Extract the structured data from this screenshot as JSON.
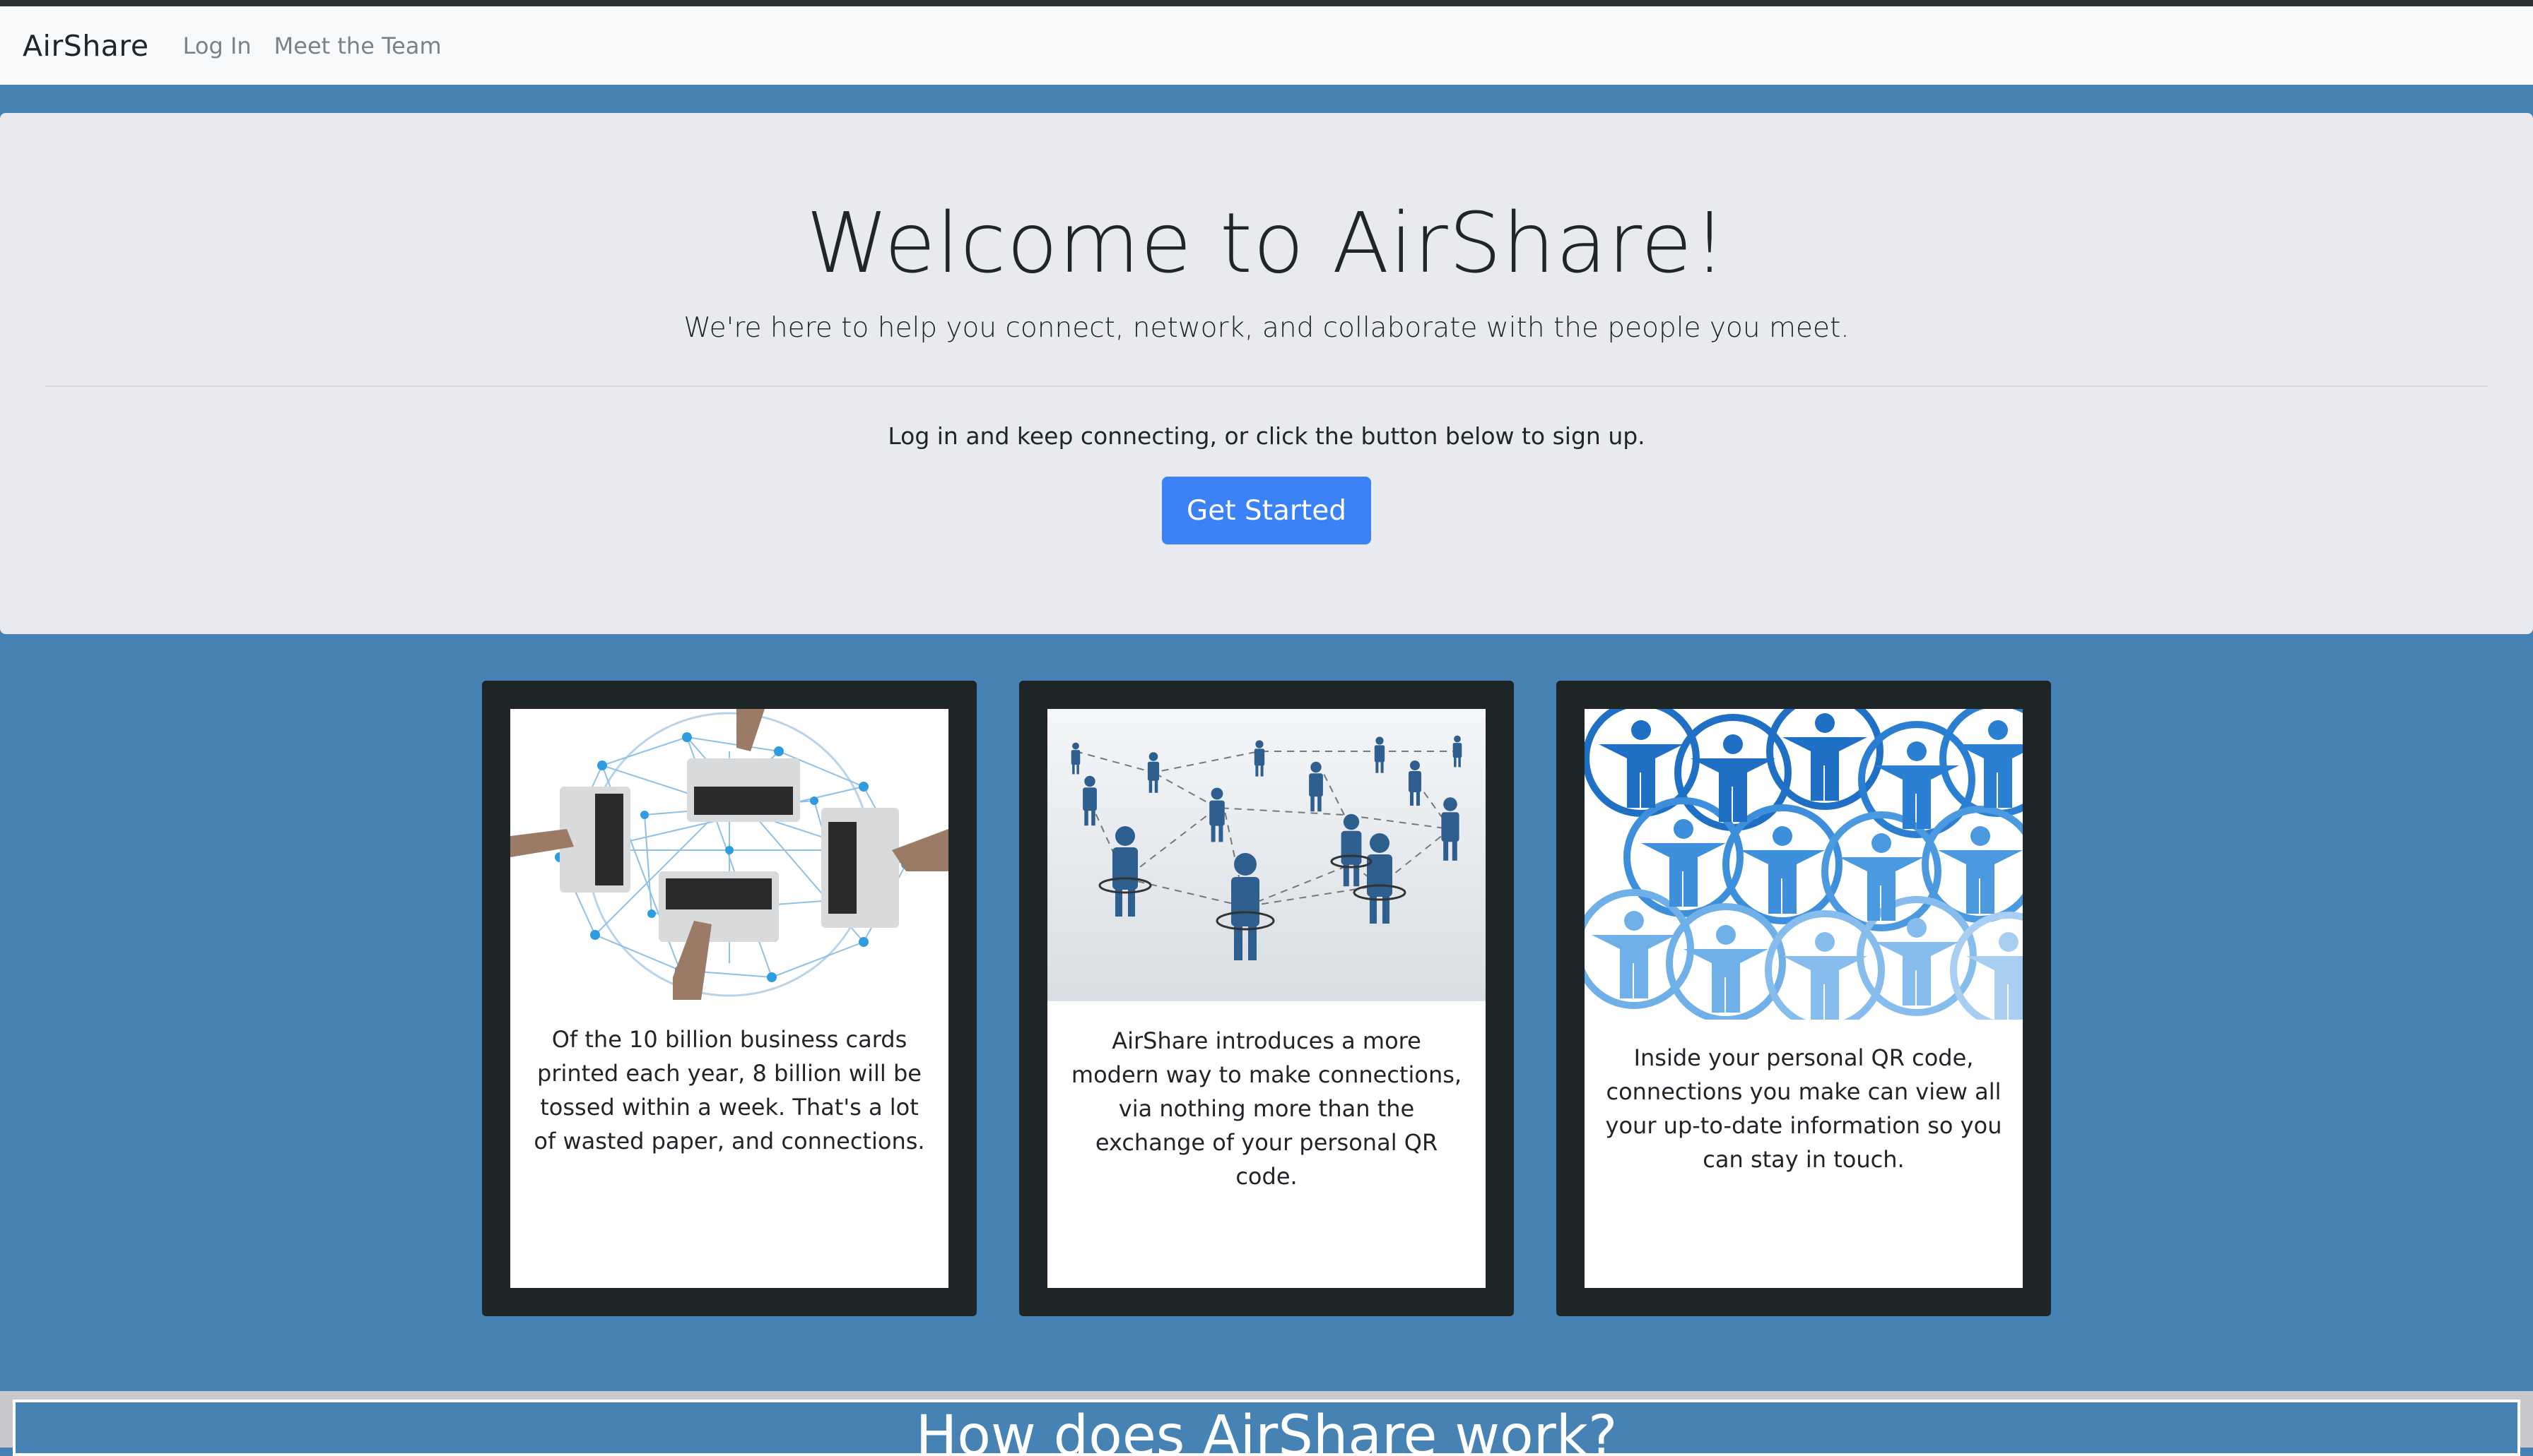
{
  "navbar": {
    "brand": "AirShare",
    "links": [
      {
        "label": "Log In"
      },
      {
        "label": "Meet the Team"
      }
    ]
  },
  "hero": {
    "title": "Welcome to AirShare!",
    "lead": "We're here to help you connect, network, and collaborate with the people you meet.",
    "text": "Log in and keep connecting, or click the button below to sign up.",
    "button": "Get Started"
  },
  "cards": [
    {
      "image_icon": "laptops-network-image",
      "text": "Of the 10 billion business cards printed each year, 8 billion will be tossed within a week. That's a lot of wasted paper, and connections."
    },
    {
      "image_icon": "people-network-image",
      "text": "AirShare introduces a more modern way to make connections, via nothing more than the exchange of your personal QR code."
    },
    {
      "image_icon": "people-circles-image",
      "text": "Inside your personal QR code, connections you make can view all your up-to-date information so you can stay in touch."
    }
  ],
  "how_section": {
    "title": "How does AirShare work?"
  },
  "colors": {
    "page_background": "#4682b4",
    "navbar_background": "#f8f9fa",
    "jumbotron_background": "#e9eaef",
    "button_primary": "#3b82f6",
    "card_frame": "#1f2628"
  }
}
